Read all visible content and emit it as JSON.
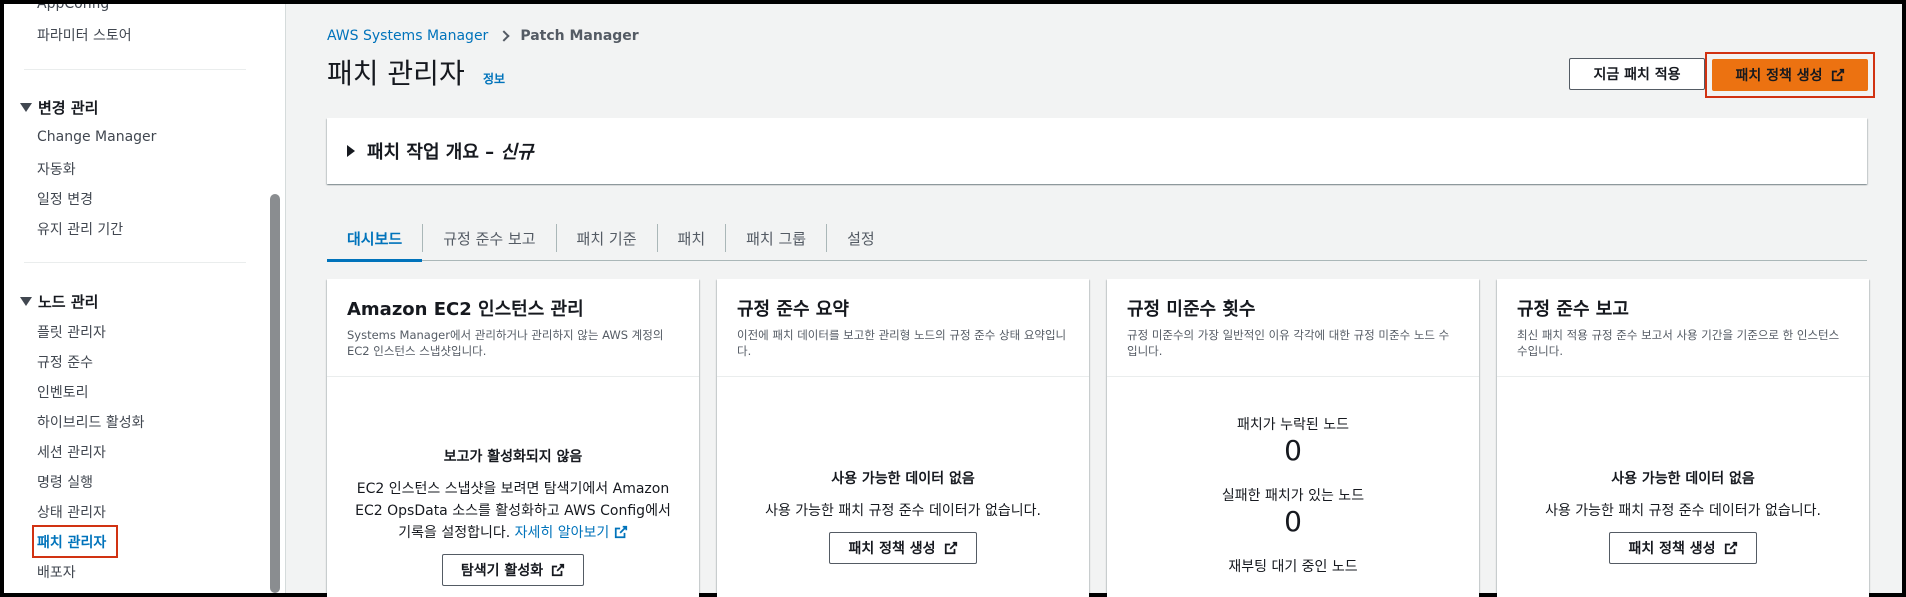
{
  "sidebar": {
    "items_top": [
      "AppConfig",
      "파라미터 스토어"
    ],
    "sections": [
      {
        "title": "변경 관리",
        "items": [
          "Change Manager",
          "자동화",
          "일정 변경",
          "유지 관리 기간"
        ]
      },
      {
        "title": "노드 관리",
        "items": [
          "플릿 관리자",
          "규정 준수",
          "인벤토리",
          "하이브리드 활성화",
          "세션 관리자",
          "명령 실행",
          "상태 관리자",
          "패치 관리자",
          "배포자"
        ]
      }
    ]
  },
  "breadcrumb": {
    "root": "AWS Systems Manager",
    "current": "Patch Manager"
  },
  "page": {
    "title": "패치 관리자",
    "info": "정보"
  },
  "header_buttons": {
    "apply_now": "지금 패치 적용",
    "create_policy": "패치 정책 생성"
  },
  "expand_panel": {
    "title": "패치 작업 개요 – ",
    "badge": "신규"
  },
  "tabs": [
    "대시보드",
    "규정 준수 보고",
    "패치 기준",
    "패치",
    "패치 그룹",
    "설정"
  ],
  "cards": {
    "ec2": {
      "title": "Amazon EC2 인스턴스 관리",
      "desc": "Systems Manager에서 관리하거나 관리하지 않는 AWS 계정의 EC2 인스턴스 스냅샷입니다.",
      "empty_title": "보고가 활성화되지 않음",
      "empty_desc": "EC2 인스턴스 스냅샷을 보려면 탐색기에서 Amazon EC2 OpsData 소스를 활성화하고 AWS Config에서 기록을 설정합니다.",
      "link": "자세히 알아보기",
      "button": "탐색기 활성화"
    },
    "summary": {
      "title": "규정 준수 요약",
      "desc": "이전에 패치 데이터를 보고한 관리형 노드의 규정 준수 상태 요약입니다.",
      "empty_title": "사용 가능한 데이터 없음",
      "empty_desc": "사용 가능한 패치 규정 준수 데이터가 없습니다.",
      "button": "패치 정책 생성"
    },
    "noncompliance": {
      "title": "규정 미준수 횟수",
      "desc": "규정 미준수의 가장 일반적인 이유 각각에 대한 규정 미준수 노드 수입니다.",
      "metrics": [
        {
          "label": "패치가 누락된 노드",
          "value": "0"
        },
        {
          "label": "실패한 패치가 있는 노드",
          "value": "0"
        },
        {
          "label": "재부팅 대기 중인 노드",
          "value": ""
        }
      ]
    },
    "report": {
      "title": "규정 준수 보고",
      "desc": "최신 패치 적용 규정 준수 보고서 사용 기간을 기준으로 한 인스턴스 수입니다.",
      "empty_title": "사용 가능한 데이터 없음",
      "empty_desc": "사용 가능한 패치 규정 준수 데이터가 없습니다.",
      "button": "패치 정책 생성"
    }
  }
}
